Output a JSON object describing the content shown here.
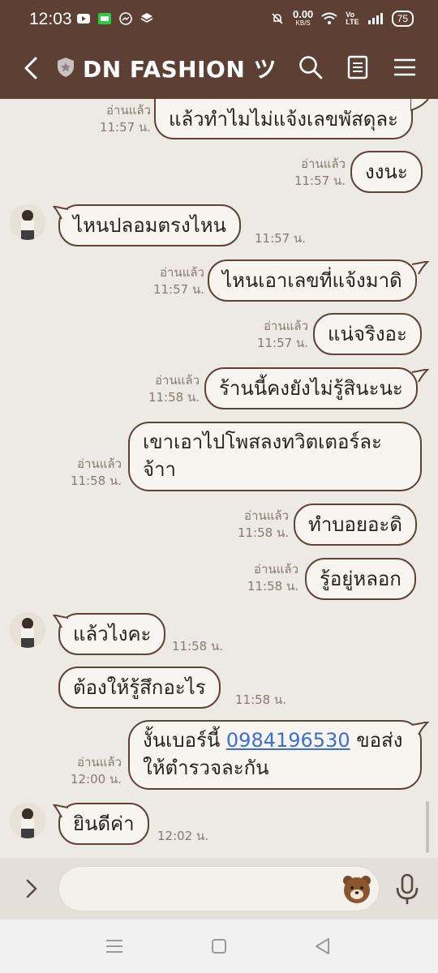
{
  "statusbar": {
    "time": "12:03",
    "net_speed_top": "0.00",
    "net_speed_bottom": "KB/S",
    "volte_top": "Vo",
    "volte_bottom": "LTE",
    "battery": "75"
  },
  "header": {
    "title": "DN FASHION ツ"
  },
  "messages": [
    {
      "side": "right",
      "text": "แล้วทำไมไม่แจ้งเลขพัสดุละ",
      "read": "อ่านแล้ว",
      "time": "11:57 น."
    },
    {
      "side": "right",
      "text": "งงนะ",
      "read": "อ่านแล้ว",
      "time": "11:57 น."
    },
    {
      "side": "left",
      "text": "ไหนปลอมตรงไหน",
      "time": "11:57 น."
    },
    {
      "side": "right",
      "text": "ไหนเอาเลขที่แจ้งมาดิ",
      "read": "อ่านแล้ว",
      "time": "11:57 น."
    },
    {
      "side": "right",
      "text": "แน่จริงอะ",
      "read": "อ่านแล้ว",
      "time": "11:57 น."
    },
    {
      "side": "right",
      "text": "ร้านนี้คงยังไม่รู้สินะนะ",
      "read": "อ่านแล้ว",
      "time": "11:58 น."
    },
    {
      "side": "right",
      "line1": "เขาเอาไปโพสลงทวิตเตอร์ละ",
      "line2": "จ้าา",
      "read": "อ่านแล้ว",
      "time": "11:58 น."
    },
    {
      "side": "right",
      "text": "ทำบอยอะดิ",
      "read": "อ่านแล้ว",
      "time": "11:58 น."
    },
    {
      "side": "right",
      "text": "รู้อยู่หลอก",
      "read": "อ่านแล้ว",
      "time": "11:58 น."
    },
    {
      "side": "left",
      "text": "แล้วไงคะ",
      "time": "11:58 น."
    },
    {
      "side": "left",
      "text": "ต้องให้รู้สึกอะไร",
      "time": "11:58 น."
    },
    {
      "side": "right",
      "prefix": "งั้นเบอร์นี้ ",
      "link": "0984196530",
      "suffix": " ขอส่ง",
      "line2": "ให้ตำรวจละกัน",
      "read": "อ่านแล้ว",
      "time": "12:00 น."
    },
    {
      "side": "left",
      "text": "ยินดีค่า",
      "time": "12:02 น."
    }
  ],
  "input": {
    "value": "",
    "placeholder": ""
  },
  "icons": {
    "back": "chevron-left-icon",
    "shield": "shield-star-icon",
    "search": "search-icon",
    "notes": "notes-icon",
    "menu": "hamburger-menu-icon",
    "expand": "chevron-right-icon",
    "sticker": "bear-sticker-icon",
    "mic": "microphone-icon"
  },
  "colors": {
    "header_bg": "#5d4033",
    "chat_bg": "#ede9e3",
    "bubble_border": "#5e4436",
    "bubble_bg": "#f8f5f0",
    "meta_text": "#8a7a6e",
    "link": "#3a6fd6"
  }
}
